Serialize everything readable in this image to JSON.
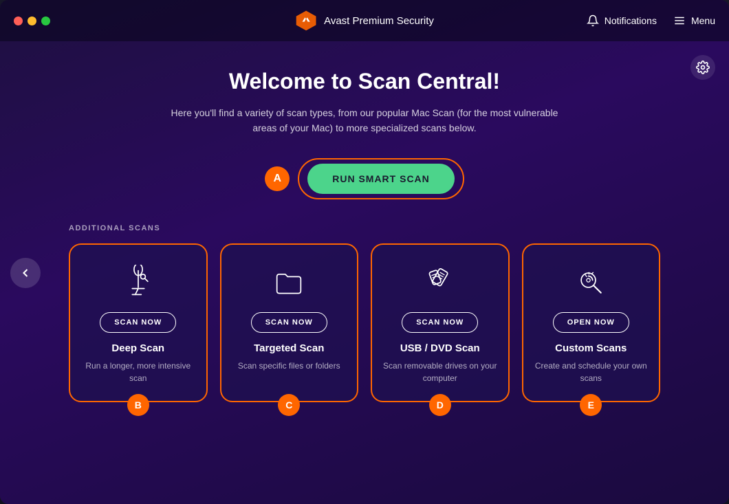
{
  "titlebar": {
    "app_name": "Avast Premium Security",
    "notifications_label": "Notifications",
    "menu_label": "Menu"
  },
  "main": {
    "title": "Welcome to Scan Central!",
    "subtitle": "Here you'll find a variety of scan types, from our popular Mac Scan (for the most vulnerable areas of your Mac) to more specialized scans below.",
    "smart_scan_badge": "A",
    "run_smart_scan_label": "RUN SMART SCAN",
    "additional_scans_label": "ADDITIONAL SCANS",
    "cards": [
      {
        "badge": "B",
        "action_label": "SCAN NOW",
        "title": "Deep Scan",
        "description": "Run a longer, more intensive scan",
        "icon": "microscope"
      },
      {
        "badge": "C",
        "action_label": "SCAN NOW",
        "title": "Targeted Scan",
        "description": "Scan specific files or folders",
        "icon": "folder"
      },
      {
        "badge": "D",
        "action_label": "SCAN NOW",
        "title": "USB / DVD Scan",
        "description": "Scan removable drives on your computer",
        "icon": "usb"
      },
      {
        "badge": "E",
        "action_label": "OPEN NOW",
        "title": "Custom Scans",
        "description": "Create and schedule your own scans",
        "icon": "settings-search"
      }
    ]
  },
  "icons": {
    "back_arrow": "‹",
    "settings": "⚙",
    "bell": "🔔",
    "menu_lines": "≡"
  }
}
